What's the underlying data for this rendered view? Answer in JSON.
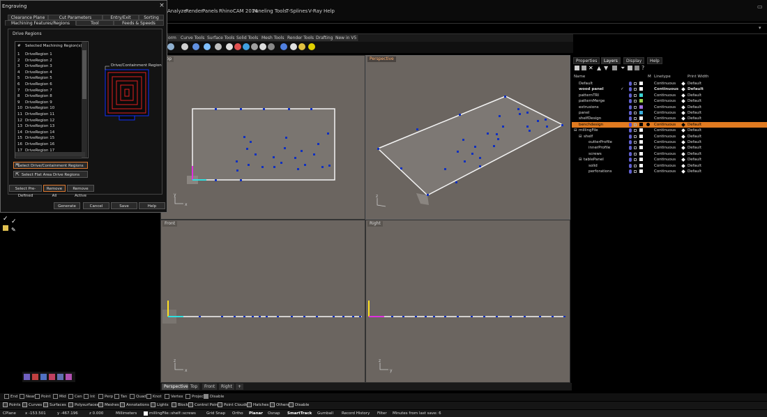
{
  "menu": [
    "Analyze",
    "Render",
    "Panels",
    "RhinoCAM 2014",
    "Paneling Tools",
    "T-Splines",
    "V-Ray",
    "Help"
  ],
  "toolbar_tabs": [
    "orm",
    "Curve Tools",
    "Surface Tools",
    "Solid Tools",
    "Mesh Tools",
    "Render Tools",
    "Drafting",
    "New in V5"
  ],
  "dialog": {
    "title": "Engraving",
    "close": "×",
    "tabs_row1": [
      "Clearance Plane",
      "Cut Parameters",
      "Entry/Exit",
      "Sorting"
    ],
    "tabs_row2": [
      "Machining Features/Regions",
      "Tool",
      "Feeds & Speeds"
    ],
    "group_label": "Drive Regions",
    "list_header_num": "#",
    "list_header_label": "Selected Machining Region(s)",
    "regions": [
      "DriveRegion 1",
      "DriveRegion 2",
      "DriveRegion 3",
      "DriveRegion 4",
      "DriveRegion 5",
      "DriveRegion 6",
      "DriveRegion 7",
      "DriveRegion 8",
      "DriveRegion 9",
      "DriveRegion 10",
      "DriveRegion 11",
      "DriveRegion 12",
      "DriveRegion 13",
      "DriveRegion 14",
      "DriveRegion 15",
      "DriveRegion 16",
      "DriveRegion 17"
    ],
    "preview_label": "Drive/Containment Region",
    "select_drive_btn": "Select Drive/Containment Regions",
    "select_flat_btn": "Select Flat Area Drive Regions",
    "select_predefined": "Select Pre-Defined",
    "remove_all": "Remove All",
    "remove_active": "Remove Active",
    "generate": "Generate",
    "cancel": "Cancel",
    "save": "Save",
    "help": "Help"
  },
  "viewports": {
    "top": "Top",
    "perspective": "Perspective",
    "front": "Front",
    "right": "Right",
    "axis_x": "x",
    "axis_y": "y",
    "axis_z": "z"
  },
  "viewport_tabs": [
    "Perspective",
    "Top",
    "Front",
    "Right",
    "+"
  ],
  "layers_panel": {
    "tabs": [
      "Properties",
      "Layers",
      "Display",
      "Help"
    ],
    "col_name": "Name",
    "col_m": "M",
    "col_linetype": "Linetype",
    "col_printwidth": "Print Width",
    "rows": [
      {
        "name": "Default",
        "indent": 0,
        "linetype": "Continuous",
        "width": "Default",
        "swatch": "#ffffff"
      },
      {
        "name": "wood panel",
        "indent": 0,
        "linetype": "Continuous",
        "width": "Default",
        "swatch": "#ffffff",
        "current": "✓",
        "bold": true
      },
      {
        "name": "patternTRI",
        "indent": 0,
        "linetype": "Continuous",
        "width": "Default",
        "swatch": "#3ad4d4"
      },
      {
        "name": "patternMerge",
        "indent": 0,
        "linetype": "Continuous",
        "width": "Default",
        "swatch": "#9ad44a"
      },
      {
        "name": "extrusions",
        "indent": 0,
        "linetype": "Continuous",
        "width": "Default",
        "swatch": "#a070e0"
      },
      {
        "name": "panel",
        "indent": 0,
        "linetype": "Continuous",
        "width": "Default",
        "swatch": "#3ab0e0"
      },
      {
        "name": "shelfDesign",
        "indent": 0,
        "linetype": "Continuous",
        "width": "Default",
        "swatch": "#ffffff"
      },
      {
        "name": "benchdesign",
        "indent": 0,
        "linetype": "Continuous",
        "width": "Default",
        "swatch": "#000000",
        "selected": true
      },
      {
        "name": "millingFile",
        "indent": 0,
        "linetype": "Continuous",
        "width": "Default",
        "swatch": "#ffffff",
        "expander": "⊟"
      },
      {
        "name": "shelf",
        "indent": 1,
        "linetype": "Continuous",
        "width": "Default",
        "swatch": "#ffffff",
        "expander": "⊟"
      },
      {
        "name": "outterProfile",
        "indent": 2,
        "linetype": "Continuous",
        "width": "Default",
        "swatch": "#ffffff"
      },
      {
        "name": "innerProfile",
        "indent": 2,
        "linetype": "Continuous",
        "width": "Default",
        "swatch": "#ffffff"
      },
      {
        "name": "screws",
        "indent": 2,
        "linetype": "Continuous",
        "width": "Default",
        "swatch": "#ffffff"
      },
      {
        "name": "tablePanel",
        "indent": 1,
        "linetype": "Continuous",
        "width": "Default",
        "swatch": "#ffffff",
        "expander": "⊟"
      },
      {
        "name": "solid",
        "indent": 2,
        "linetype": "Continuous",
        "width": "Default",
        "swatch": "#ffffff"
      },
      {
        "name": "perforations",
        "indent": 2,
        "linetype": "Continuous",
        "width": "Default",
        "swatch": "#ffffff"
      }
    ]
  },
  "osnaps": [
    "End",
    "Near",
    "Point",
    "Mid",
    "Cen",
    "Int",
    "Perp",
    "Tan",
    "Quad",
    "Knot",
    "Vertex",
    "Project",
    "Disable"
  ],
  "filters": [
    "Points",
    "Curves",
    "Surfaces",
    "Polysurfaces",
    "Meshes",
    "Annotations",
    "Lights",
    "Blocks",
    "Control Points",
    "Point Clouds",
    "Hatches",
    "Others",
    "Disable"
  ],
  "status": {
    "cplane": "CPlane",
    "x": "x -153.501",
    "y": "y -467.196",
    "z": "z 0.000",
    "units": "Millimeters",
    "layer": "millingFile::shelf::screws",
    "grid_snap": "Grid Snap",
    "ortho": "Ortho",
    "planar": "Planar",
    "osnap": "Osnap",
    "smarttrack": "SmartTrack",
    "gumball": "Gumball",
    "record_history": "Record History",
    "filter": "Filter",
    "last_save": "Minutes from last save: 6"
  },
  "colors": {
    "accent": "#e07a20",
    "viewport_bg": "#6b6560",
    "point": "#1030c0"
  }
}
